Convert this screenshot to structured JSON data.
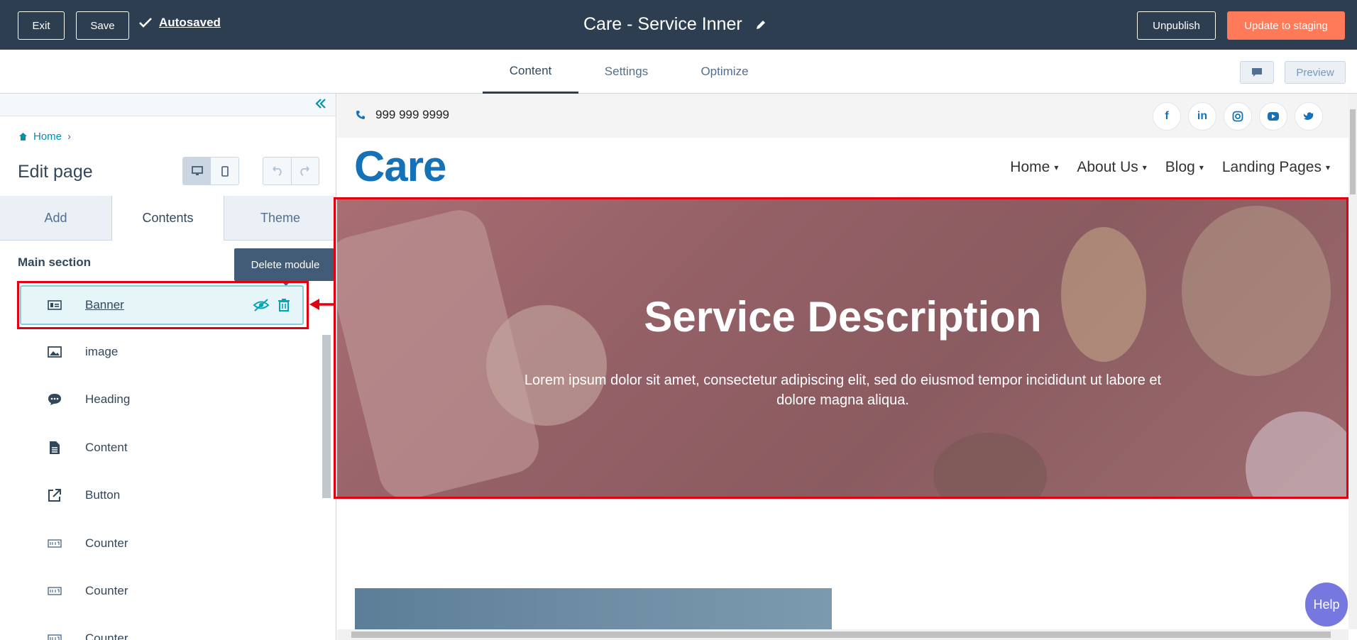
{
  "topbar": {
    "exit_label": "Exit",
    "save_label": "Save",
    "autosaved_label": "Autosaved",
    "page_title": "Care - Service Inner",
    "unpublish_label": "Unpublish",
    "update_label": "Update to staging"
  },
  "tabs": [
    {
      "label": "Content",
      "active": true
    },
    {
      "label": "Settings",
      "active": false
    },
    {
      "label": "Optimize",
      "active": false
    }
  ],
  "preview_label": "Preview",
  "sidebar": {
    "breadcrumb": "Home",
    "edit_title": "Edit page",
    "panel_tabs": [
      "Add",
      "Contents",
      "Theme"
    ],
    "active_panel_tab": "Contents",
    "section_title": "Main section",
    "tooltip": "Delete module",
    "modules": [
      {
        "label": "Banner",
        "icon": "banner-icon",
        "selected": true
      },
      {
        "label": "image",
        "icon": "image-icon"
      },
      {
        "label": "Heading",
        "icon": "heading-icon"
      },
      {
        "label": "Content",
        "icon": "content-icon"
      },
      {
        "label": "Button",
        "icon": "button-icon"
      },
      {
        "label": "Counter",
        "icon": "counter-icon"
      },
      {
        "label": "Counter",
        "icon": "counter-icon"
      },
      {
        "label": "Counter",
        "icon": "counter-icon"
      }
    ]
  },
  "site": {
    "phone": "999 999 9999",
    "logo": "Care",
    "socials": [
      "f",
      "in",
      "ig",
      "yt",
      "tw"
    ],
    "nav": [
      "Home",
      "About Us",
      "Blog",
      "Landing Pages"
    ],
    "banner_title": "Service Description",
    "banner_text": "Lorem ipsum dolor sit amet, consectetur adipiscing elit, sed do eiusmod tempor incididunt ut labore et dolore magna aliqua."
  },
  "help_label": "Help",
  "colors": {
    "topbar": "#2d3e50",
    "accent_orange": "#ff7a59",
    "highlight_red": "#e3000f",
    "brand_blue": "#1572b8"
  }
}
